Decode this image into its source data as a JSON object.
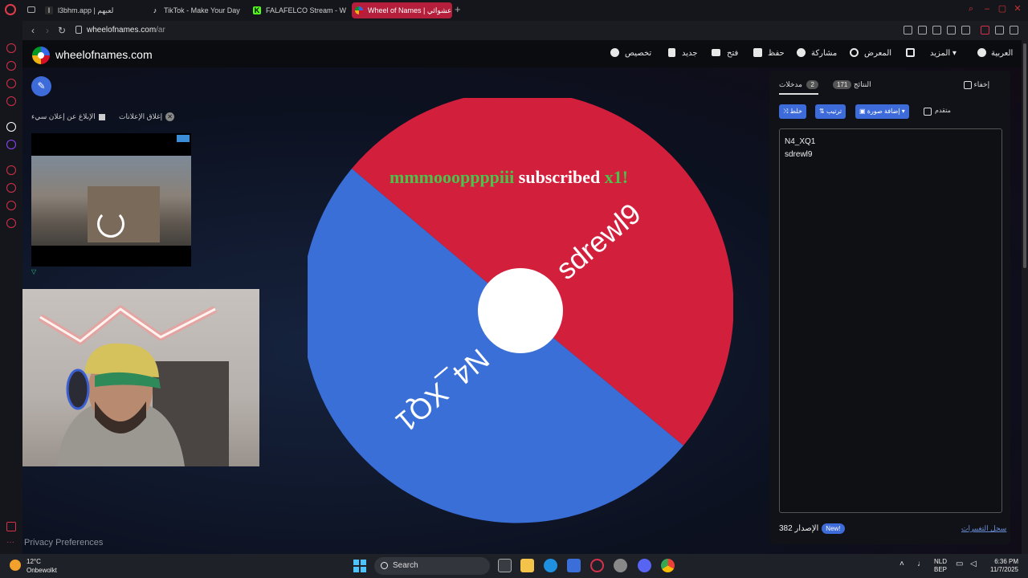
{
  "browser": {
    "tabs": [
      {
        "label": "l3bhm.app | لعبهم",
        "icon": "l3bhm-icon"
      },
      {
        "label": "TikTok - Make Your Day",
        "icon": "tiktok-icon"
      },
      {
        "label": "FALAFELCO Stream - Wa",
        "icon": "kick-icon"
      },
      {
        "label": "Wheel of Names | عشوائي",
        "icon": "wheel-icon"
      }
    ],
    "new_tab": "+",
    "url_host": "wheelofnames.com",
    "url_path": "/ar"
  },
  "site": {
    "brand": "wheelofnames.com",
    "menu": {
      "customize": "تخصيص",
      "new": "جديد",
      "open": "فتح",
      "save": "حفظ",
      "share": "مشاركة",
      "gallery": "المعرض",
      "more": "المزيد",
      "language": "العربية"
    }
  },
  "ads": {
    "close_ads": "إغلاق الإعلانات",
    "report_ad": "الإبلاغ عن إعلان سيء",
    "choices": "▽"
  },
  "wheel": {
    "segments": [
      {
        "label": "sdrewl9",
        "color": "#d21f3c"
      },
      {
        "label": "N4_XQ1",
        "color": "#3a6fd8"
      }
    ],
    "pointer_color": "#d21f3c",
    "overlay": {
      "user": "mmmoooppppiii",
      "action": "subscribed",
      "count": "x1!"
    },
    "privacy": "Privacy Preferences"
  },
  "panel": {
    "hide_label": "إخفاء",
    "tab_results": {
      "label": "النتائج",
      "count": "171"
    },
    "tab_entries": {
      "label": "مدخلات",
      "count": "2"
    },
    "advanced_label": "متقدم",
    "add_image": "إضافة صورة",
    "sort": "ترتيب",
    "shuffle": "خلط",
    "entries": [
      "N4_XQ1",
      "sdrewl9"
    ],
    "version_label": "الإصدار 382",
    "new_badge": "New!",
    "changelog": "سجل التغييرات"
  },
  "taskbar": {
    "temp": "12°C",
    "weather": "Onbewolkt",
    "search": "Search",
    "lang1": "NLD",
    "lang2": "BEP",
    "time": "6:36 PM",
    "date": "11/7/2025"
  }
}
